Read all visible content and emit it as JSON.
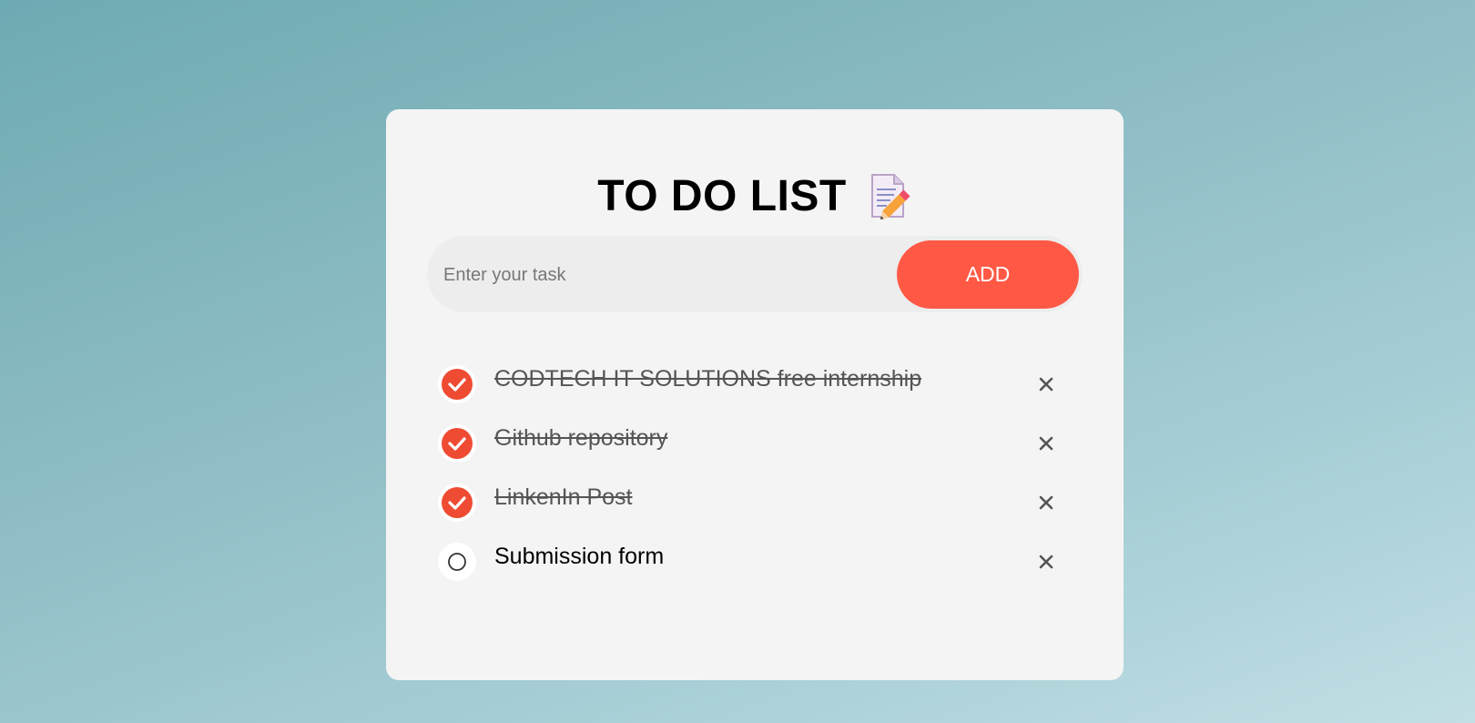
{
  "app": {
    "title": "TO DO LIST",
    "title_icon": "memo-pencil-icon"
  },
  "input": {
    "placeholder": "Enter your task",
    "value": ""
  },
  "add_button": {
    "label": "ADD"
  },
  "colors": {
    "accent": "#ff5945",
    "check_fill": "#ee4b32",
    "card_bg": "#f4f4f4"
  },
  "tasks": [
    {
      "text": "CODTECH IT SOLUTIONS free internship",
      "done": true
    },
    {
      "text": "Github repository",
      "done": true
    },
    {
      "text": "LinkenIn Post",
      "done": true
    },
    {
      "text": "Submission form",
      "done": false
    }
  ]
}
